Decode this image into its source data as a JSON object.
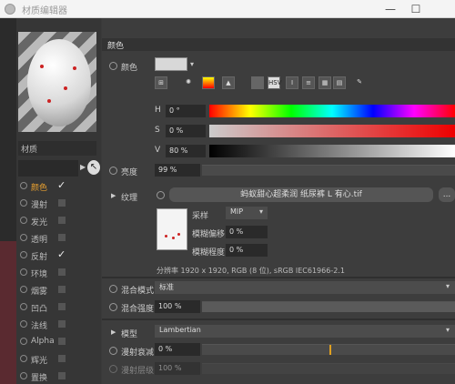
{
  "window": {
    "title": "材质编辑器",
    "minimize": "—",
    "maximize": "☐"
  },
  "sidebar": {
    "material_name": "材质",
    "channels": [
      {
        "label": "颜色",
        "checked": true,
        "active": true
      },
      {
        "label": "漫射",
        "checked": false
      },
      {
        "label": "发光",
        "checked": false
      },
      {
        "label": "透明",
        "checked": false
      },
      {
        "label": "反射",
        "checked": true
      },
      {
        "label": "环境",
        "checked": false
      },
      {
        "label": "烟雾",
        "checked": false
      },
      {
        "label": "凹凸",
        "checked": false
      },
      {
        "label": "法线",
        "checked": false
      },
      {
        "label": "Alpha",
        "checked": false
      },
      {
        "label": "辉光",
        "checked": false
      },
      {
        "label": "置换",
        "checked": false
      }
    ]
  },
  "panel": {
    "section_title": "颜色",
    "color_label": "颜色",
    "toolbar_active": "HSV",
    "hsv": [
      {
        "letter": "H",
        "value": "0 °"
      },
      {
        "letter": "S",
        "value": "0 %"
      },
      {
        "letter": "V",
        "value": "80 %"
      }
    ],
    "brightness": {
      "label": "亮度",
      "value": "99 %"
    },
    "texture": {
      "label": "纹理",
      "filename": "蚂蚁甜心超柔润 纸尿裤 L 有心.tif",
      "more": "..."
    },
    "sampling": {
      "label": "采样",
      "value": "MIP"
    },
    "blur_offset": {
      "label": "模糊偏移",
      "value": "0 %"
    },
    "blur_degree": {
      "label": "模糊程度",
      "value": "0 %"
    },
    "resolution_info": "分辨率 1920 x 1920, RGB (8 位), sRGB IEC61966-2.1",
    "mix_mode": {
      "label": "混合模式",
      "value": "标准"
    },
    "mix_strength": {
      "label": "混合强度",
      "value": "100 %"
    },
    "model": {
      "label": "模型",
      "value": "Lambertian"
    },
    "diffuse_falloff": {
      "label": "漫射衰减",
      "value": "0 %"
    },
    "diffuse_level": {
      "label": "漫射层级",
      "value": "100 %"
    }
  }
}
